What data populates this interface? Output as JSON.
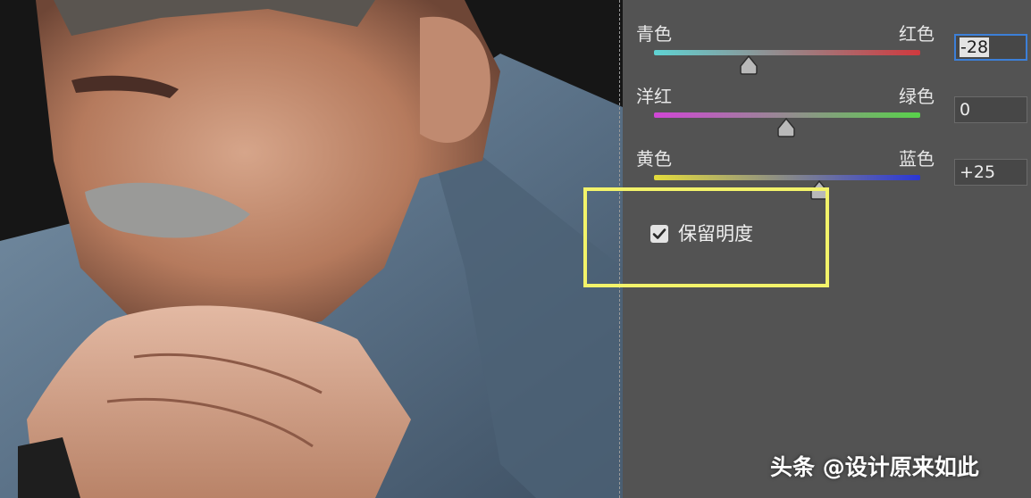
{
  "color_balance": {
    "sliders": [
      {
        "left_label": "青色",
        "right_label": "红色",
        "value": "-28",
        "value_numeric": -28,
        "focused": true,
        "gradient": [
          "#5fd3d3",
          "#d0393e"
        ]
      },
      {
        "left_label": "洋红",
        "right_label": "绿色",
        "value": "0",
        "value_numeric": 0,
        "focused": false,
        "gradient": [
          "#d146d6",
          "#58d24a"
        ]
      },
      {
        "left_label": "黄色",
        "right_label": "蓝色",
        "value": "+25",
        "value_numeric": 25,
        "focused": false,
        "gradient": [
          "#e4dc3c",
          "#2a36d6"
        ]
      }
    ],
    "preserve_luminosity": {
      "label": "保留明度",
      "checked": true
    }
  },
  "colors": {
    "panel_bg": "#535353",
    "highlight_frame": "#f3f36a",
    "focus_ring": "#3c7fd8"
  },
  "watermark": "头条 @设计原来如此",
  "photo": {
    "subject": "elderly-man-portrait"
  }
}
